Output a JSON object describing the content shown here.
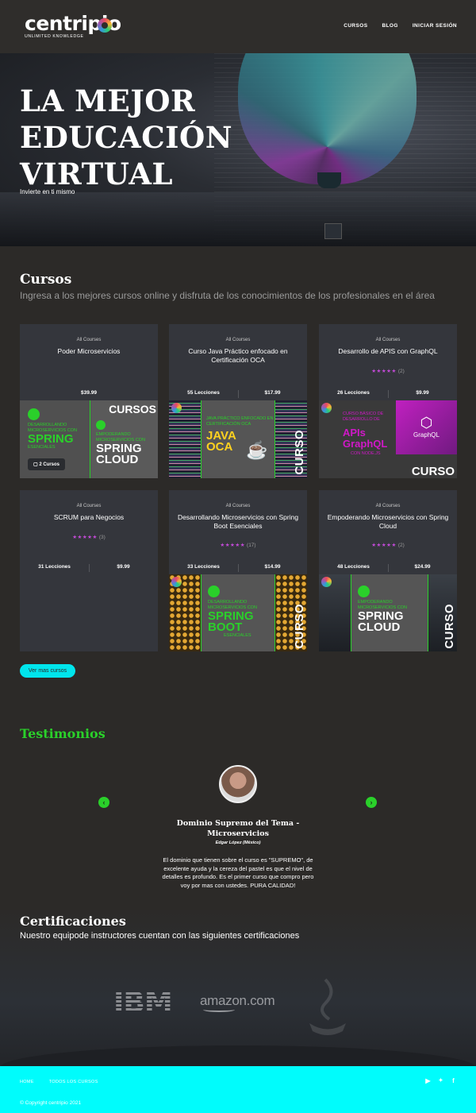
{
  "header": {
    "logo_text": "centripio",
    "logo_tagline": "UNLIMITED KNOWLEDGE",
    "nav": [
      "CURSOS",
      "BLOG",
      "INICIAR SESIÓN"
    ]
  },
  "hero": {
    "title": "LA MEJOR EDUCACIÓN VIRTUAL",
    "subtitle": "Invierte en ti mismo"
  },
  "cursos": {
    "title": "Cursos",
    "description": "Ingresa a los mejores cursos online y disfruta de los conocimientos de los profesionales en el área",
    "more_button": "Ver mas cursos",
    "cards": [
      {
        "category": "All Courses",
        "title": "Poder Microservicios",
        "stars": "",
        "rating_count": "",
        "lessons": "",
        "price": "$39.99",
        "badge": "2 Cursos",
        "thumb": {
          "mid_small": "DESARROLLANDO MICROSERVICIOS CON",
          "mid_big": "SPRING",
          "mid_tail": "ESENCIALES",
          "right_title": "CURSOS",
          "right_small": "EMPODERANDO MICROSERVICIOS CON",
          "right_big": "SPRING CLOUD"
        }
      },
      {
        "category": "All Courses",
        "title": "Curso Java Práctico enfocado en Certificación OCA",
        "stars": "",
        "rating_count": "",
        "lessons": "55 Lecciones",
        "price": "$17.99",
        "thumb": {
          "mid_small": "JAVA PRÁCTICO ENFOCADO EN CERTIFICACIÓN OCA",
          "mid_big": "JAVA OCA",
          "vertical": "CURSO"
        }
      },
      {
        "category": "All Courses",
        "title": "Desarrollo de APIS con GraphQL",
        "stars": "★★★★★",
        "rating_count": "(2)",
        "lessons": "26 Lecciones",
        "price": "$9.99",
        "thumb": {
          "mid_small": "CURSO BÁSICO DE DESARROLLO DE",
          "mid_big": "APIs GraphQL",
          "mid_tail": "CON NODE.JS",
          "right_logo": "GraphQL",
          "bottom": "CURSO"
        }
      },
      {
        "category": "All Courses",
        "title": "SCRUM para Negocios",
        "stars": "★★★★★",
        "rating_count": "(3)",
        "lessons": "31 Lecciones",
        "price": "$9.99",
        "thumb": null
      },
      {
        "category": "All Courses",
        "title": "Desarrollando Microservicios con Spring Boot Esenciales",
        "stars": "★★★★★",
        "rating_count": "(17)",
        "lessons": "33 Lecciones",
        "price": "$14.99",
        "thumb": {
          "mid_small": "DESARROLLANDO MICROSERVICIOS CON",
          "mid_big": "SPRING BOOT",
          "mid_tail": "ESENCIALES",
          "vertical": "CURSO"
        }
      },
      {
        "category": "All Courses",
        "title": "Empoderando Microservicios con Spring Cloud",
        "stars": "★★★★★",
        "rating_count": "(2)",
        "lessons": "48 Lecciones",
        "price": "$24.99",
        "thumb": {
          "mid_small": "EMPODERANDO MICROSERVICIOS CON",
          "mid_big": "SPRING CLOUD",
          "vertical": "CURSO"
        }
      }
    ]
  },
  "testimonios": {
    "title": "Testimonios",
    "prev": "‹",
    "next": "›",
    "name": "Dominio Supremo del Tema - Microservicios",
    "author": "Edgar López (México)",
    "text": "El dominio que tienen sobre el curso es \"SUPREMO\", de excelente ayuda y la cereza del pastel es que el nivel de detalles es profundo. Es el primer curso que compro pero voy por mas con ustedes. PURA CALIDAD!"
  },
  "certificaciones": {
    "title": "Certificaciones",
    "description": "Nuestro equipode instructores cuentan con las siguientes certificaciones",
    "logos": [
      "IBM",
      "amazon.com"
    ]
  },
  "footer": {
    "links": [
      "HOME",
      "TODOS LOS CURSOS"
    ],
    "social": [
      "▶",
      "🐦",
      "f"
    ],
    "copyright": "© Copyright centripio 2021"
  },
  "colors": {
    "accent": "#00e5ec",
    "green": "#2ad02a",
    "stars": "#c44bd8",
    "footer": "#00fcfc"
  }
}
